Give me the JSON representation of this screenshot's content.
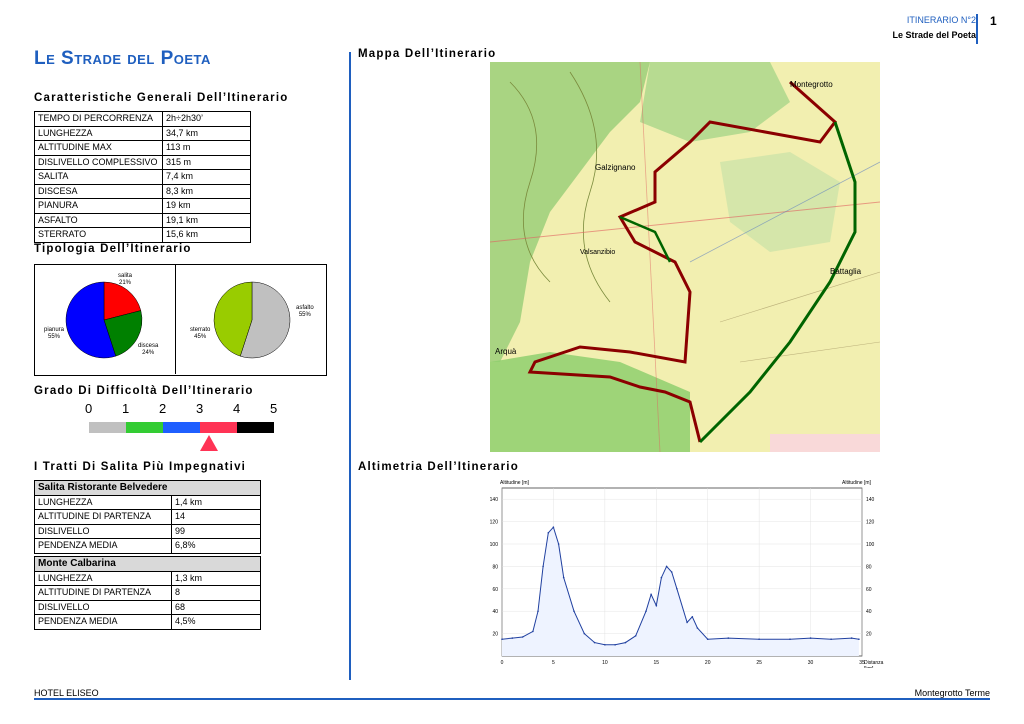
{
  "header": {
    "itinerary": "ITINERARIO N°2",
    "subtitle": "Le Strade del Poeta",
    "page": "1"
  },
  "title": "Le Strade del Poeta",
  "sections": {
    "general": "Caratteristiche Generali Dell’Itinerario",
    "typology": "Tipologia Dell’Itinerario",
    "difficulty": "Grado Di Difficoltà Dell’Itinerario",
    "climbs": "I Tratti Di Salita Più Impegnativi",
    "map": "Mappa Dell’Itinerario",
    "altimetry": "Altimetria Dell’Itinerario"
  },
  "general_rows": [
    {
      "k": "TEMPO DI PERCORRENZA",
      "v": "2h÷2h30’"
    },
    {
      "k": "LUNGHEZZA",
      "v": "34,7 km"
    },
    {
      "k": "ALTITUDINE MAX",
      "v": "113 m"
    },
    {
      "k": "DISLIVELLO COMPLESSIVO",
      "v": "315 m"
    },
    {
      "k": "SALITA",
      "v": "7,4 km"
    },
    {
      "k": "DISCESA",
      "v": "8,3 km"
    },
    {
      "k": "PIANURA",
      "v": "19 km"
    },
    {
      "k": "ASFALTO",
      "v": "19,1 km"
    },
    {
      "k": "STERRATO",
      "v": "15,6 km"
    }
  ],
  "pie1": {
    "salita": {
      "label": "salita",
      "pct": "21%",
      "value": 21,
      "color": "#ff0000"
    },
    "discesa": {
      "label": "discesa",
      "pct": "24%",
      "value": 24,
      "color": "#008000"
    },
    "pianura": {
      "label": "pianura",
      "pct": "55%",
      "value": 55,
      "color": "#0000ff"
    }
  },
  "pie2": {
    "asfalto": {
      "label": "asfalto",
      "pct": "55%",
      "value": 55,
      "color": "#c0c0c0"
    },
    "sterrato": {
      "label": "sterrato",
      "pct": "45%",
      "value": 45,
      "color": "#99cc00"
    }
  },
  "difficulty": {
    "scale": [
      "0",
      "1",
      "2",
      "3",
      "4",
      "5"
    ],
    "segments": [
      "#c0c0c0",
      "#33cc33",
      "#1f5fff",
      "#ff3355",
      "#000000"
    ],
    "level": 3.25
  },
  "climbs": [
    {
      "name": "Salita Ristorante Belvedere",
      "rows": [
        {
          "k": "LUNGHEZZA",
          "v": "1,4 km"
        },
        {
          "k": "ALTITUDINE DI PARTENZA",
          "v": "14"
        },
        {
          "k": "DISLIVELLO",
          "v": "99"
        },
        {
          "k": "PENDENZA MEDIA",
          "v": "6,8%"
        }
      ]
    },
    {
      "name": "Monte Calbarina",
      "rows": [
        {
          "k": "LUNGHEZZA",
          "v": "1,3 km"
        },
        {
          "k": "ALTITUDINE DI PARTENZA",
          "v": "8"
        },
        {
          "k": "DISLIVELLO",
          "v": "68"
        },
        {
          "k": "PENDENZA MEDIA",
          "v": "4,5%"
        }
      ]
    }
  ],
  "map": {
    "places": [
      "Montegrotto",
      "Galzignano",
      "Valsanzibio",
      "Battaglia",
      "Arquà"
    ]
  },
  "chart_data": {
    "type": "area",
    "ylabel_left": "Altitudine [m]",
    "ylabel_right": "Altitudine [m]",
    "xlabel": "Distanza",
    "xunit": "[km]",
    "xlim": [
      0,
      35
    ],
    "ylim": [
      0,
      150
    ],
    "xticks": [
      0,
      5,
      10,
      15,
      20,
      25,
      30,
      35
    ],
    "yticks": [
      20,
      40,
      60,
      80,
      100,
      120,
      140
    ],
    "x": [
      0,
      1,
      2,
      3,
      3.5,
      4,
      4.5,
      5,
      5.5,
      6,
      7,
      8,
      9,
      10,
      11,
      12,
      13,
      14,
      14.5,
      15,
      15.5,
      16,
      16.5,
      17,
      18,
      18.5,
      19,
      20,
      22,
      25,
      28,
      30,
      32,
      34,
      34.7
    ],
    "y": [
      15,
      16,
      17,
      22,
      40,
      80,
      110,
      115,
      100,
      70,
      40,
      20,
      12,
      10,
      10,
      12,
      18,
      40,
      55,
      45,
      70,
      80,
      75,
      60,
      30,
      35,
      25,
      15,
      16,
      15,
      15,
      16,
      15,
      16,
      15
    ]
  },
  "footer": {
    "left": "HOTEL ELISEO",
    "right": "Montegrotto Terme"
  }
}
